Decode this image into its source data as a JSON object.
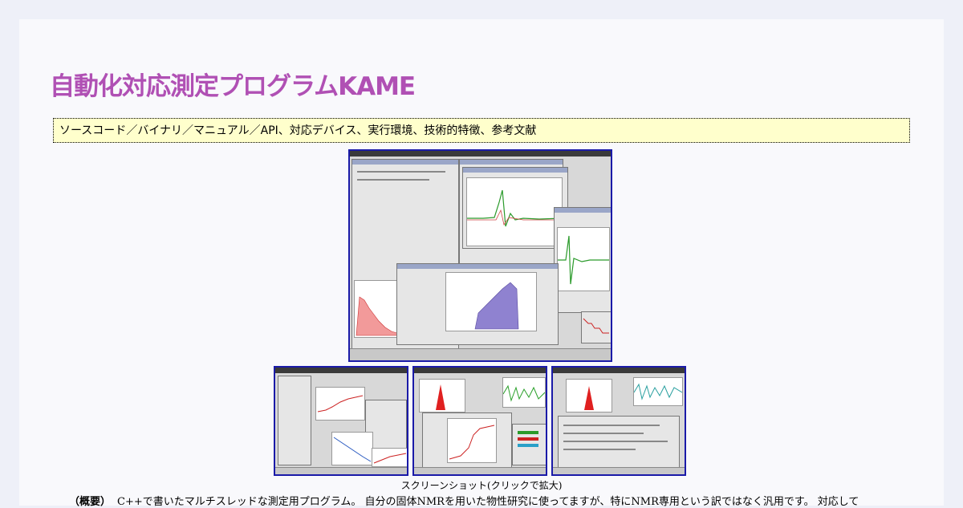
{
  "page": {
    "title": "自動化対応測定プログラムKAME",
    "nav": {
      "links": [
        "ソースコード",
        "バイナリ",
        "マニュアル",
        "API",
        "対応デバイス",
        "実行環境",
        "技術的特徴",
        "参考文献"
      ],
      "sep_slash": "／",
      "sep_comma": "、"
    },
    "screenshots": {
      "caption": "スクリーンショット(クリックで拡大)"
    },
    "summary": {
      "label": "（概要）",
      "text": "C++で書いたマルチスレッドな測定用プログラム。 自分の固体NMRを用いた物性研究に使ってますが、特にNMR専用という訳ではなく汎用です。 対応して"
    }
  },
  "colors": {
    "title": "#b050b4",
    "nav_bg": "#ffffcc",
    "thumb_border": "#1a1aa8",
    "page_bg": "#f9f9fc"
  }
}
